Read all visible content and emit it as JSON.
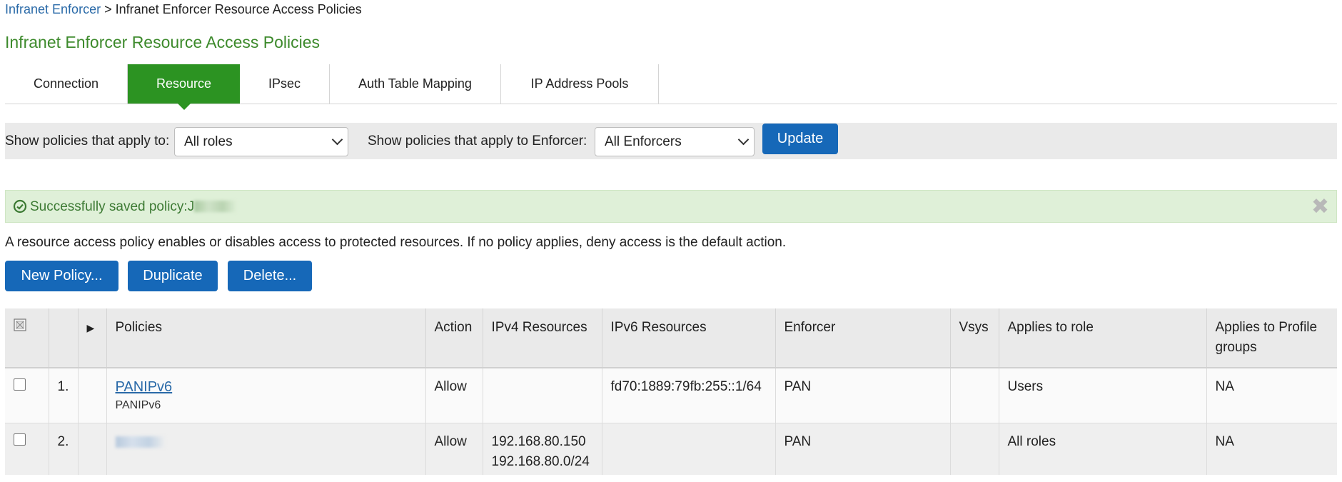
{
  "breadcrumb": {
    "parent": "Infranet Enforcer",
    "separator": ">",
    "current": "Infranet Enforcer Resource Access Policies"
  },
  "page_title": "Infranet Enforcer Resource Access Policies",
  "tabs": [
    {
      "label": "Connection",
      "active": false
    },
    {
      "label": "Resource",
      "active": true
    },
    {
      "label": "IPsec",
      "active": false
    },
    {
      "label": "Auth Table Mapping",
      "active": false
    },
    {
      "label": "IP Address Pools",
      "active": false
    }
  ],
  "filters": {
    "roles_label": "Show policies that apply to:",
    "roles_value": "All roles",
    "enforcer_label": "Show policies that apply to Enforcer:",
    "enforcer_value": "All Enforcers",
    "update_label": "Update"
  },
  "alert": {
    "message": "Successfully saved policy:J"
  },
  "description": "A resource access policy enables or disables access to protected resources. If no policy applies, deny access is the default action.",
  "actions": {
    "new_policy": "New Policy...",
    "duplicate": "Duplicate",
    "delete": "Delete..."
  },
  "table": {
    "headers": {
      "policies": "Policies",
      "action": "Action",
      "ipv4": "IPv4 Resources",
      "ipv6": "IPv6 Resources",
      "enforcer": "Enforcer",
      "vsys": "Vsys",
      "role": "Applies to role",
      "profile": "Applies to Profile groups"
    },
    "rows": [
      {
        "index": "1.",
        "name": "PANIPv6",
        "subname": "PANIPv6",
        "action": "Allow",
        "ipv4_1": "",
        "ipv4_2": "",
        "ipv6": "fd70:1889:79fb:255::1/64",
        "enforcer": "PAN",
        "vsys": "",
        "role": "Users",
        "profile": "NA"
      },
      {
        "index": "2.",
        "name": "",
        "subname": "",
        "action": "Allow",
        "ipv4_1": "192.168.80.150",
        "ipv4_2": "192.168.80.0/24",
        "ipv6": "",
        "enforcer": "PAN",
        "vsys": "",
        "role": "All roles",
        "profile": "NA"
      }
    ]
  },
  "colors": {
    "title_green": "#3d8a2c",
    "tab_active": "#2c9322",
    "button_blue": "#1668b8",
    "link_blue": "#2a6aa8",
    "alert_bg": "#dff0d8"
  }
}
